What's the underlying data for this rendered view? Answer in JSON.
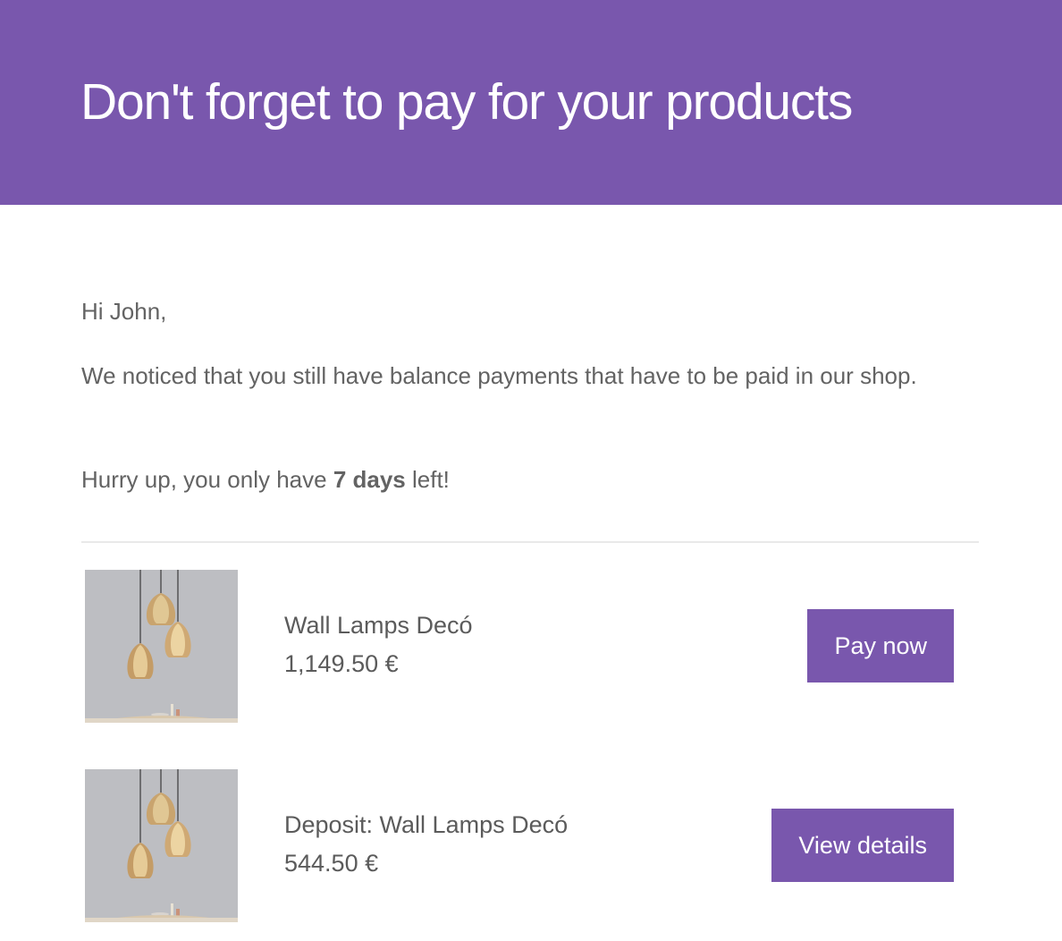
{
  "header": {
    "title": "Don't forget to pay for your products"
  },
  "body": {
    "greeting": "Hi John,",
    "message": "We noticed that you still have balance payments that have to be paid in our shop.",
    "hurry_prefix": "Hurry up, you only have ",
    "hurry_bold": "7 days",
    "hurry_suffix": " left!"
  },
  "products": [
    {
      "name": "Wall Lamps Decó",
      "price": "1,149.50 €",
      "action": "Pay now",
      "image": "pendant-lamps-image"
    },
    {
      "name": "Deposit: Wall Lamps Decó",
      "price": "544.50 €",
      "action": "View details",
      "image": "pendant-lamps-image"
    }
  ],
  "colors": {
    "accent": "#7957ad",
    "text": "#636363",
    "divider": "#e9e9e9"
  }
}
